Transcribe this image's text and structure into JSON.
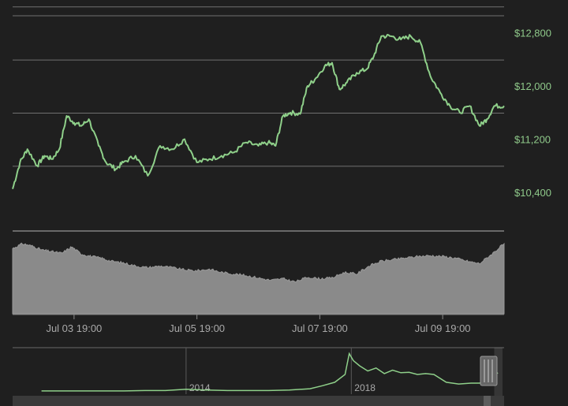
{
  "chart_data": [
    {
      "type": "line",
      "title": "",
      "xlabel": "",
      "ylabel": "",
      "ylim": [
        10150,
        13200
      ],
      "y_ticks": [
        {
          "value": 12800,
          "label": "$12,800"
        },
        {
          "value": 12000,
          "label": "$12,000"
        },
        {
          "value": 11200,
          "label": "$11,200"
        },
        {
          "value": 10400,
          "label": "$10,400"
        }
      ],
      "series": [
        {
          "color": "#8fd08a",
          "x": [
            0,
            0.3,
            0.6,
            1.0,
            1.3,
            1.6,
            1.9,
            2.2,
            2.5,
            2.8,
            3.1,
            3.5,
            3.8,
            4.2,
            4.5,
            5.0,
            5.5,
            6.0,
            6.5,
            7.0,
            7.5,
            8.0,
            8.5,
            9.0,
            9.5,
            10.0,
            10.4,
            10.7,
            11.0,
            11.3,
            11.7,
            12.0,
            12.3,
            12.7,
            13.0,
            13.3,
            13.6,
            14.0,
            14.4,
            14.7,
            15.0,
            15.4,
            15.8,
            16.2,
            16.6,
            17.0,
            17.4,
            17.8,
            18.2,
            18.6,
            19.0,
            19.3,
            19.6,
            20.0
          ],
          "y": [
            10450,
            10850,
            11050,
            10800,
            10950,
            10900,
            11050,
            11550,
            11450,
            11400,
            11500,
            11100,
            10850,
            10750,
            10850,
            10950,
            10650,
            11100,
            11050,
            11200,
            10850,
            10900,
            10950,
            11000,
            11150,
            11100,
            11150,
            11100,
            11550,
            11600,
            11580,
            12000,
            12100,
            12300,
            12350,
            11950,
            12050,
            12200,
            12250,
            12450,
            12750,
            12750,
            12700,
            12750,
            12650,
            12150,
            11900,
            11700,
            11600,
            11700,
            11400,
            11500,
            11700,
            11700
          ]
        }
      ],
      "x_ticks": [
        {
          "value": 2.5,
          "label": "Jul 03 19:00"
        },
        {
          "value": 7.5,
          "label": "Jul 05 19:00"
        },
        {
          "value": 12.5,
          "label": "Jul 07 19:00"
        },
        {
          "value": 17.5,
          "label": "Jul 09 19:00"
        }
      ]
    },
    {
      "type": "area",
      "title": "",
      "xlabel": "",
      "ylabel": "",
      "ylim": [
        0,
        100
      ],
      "series": [
        {
          "color": "#8a8a8a",
          "x": [
            0,
            0.4,
            0.8,
            1.2,
            1.6,
            2.0,
            2.4,
            2.8,
            3.2,
            3.6,
            4.0,
            4.5,
            5.0,
            5.5,
            6.0,
            6.5,
            7.0,
            7.5,
            8.0,
            8.5,
            9.0,
            9.5,
            10.0,
            10.5,
            11.0,
            11.5,
            12.0,
            12.5,
            13.0,
            13.5,
            14.0,
            14.5,
            15.0,
            15.5,
            16.0,
            16.5,
            17.0,
            17.5,
            18.0,
            18.5,
            19.0,
            19.5,
            20.0
          ],
          "y": [
            82,
            88,
            85,
            80,
            78,
            76,
            84,
            75,
            72,
            70,
            66,
            64,
            60,
            58,
            60,
            58,
            55,
            54,
            56,
            52,
            50,
            48,
            45,
            42,
            44,
            40,
            46,
            44,
            45,
            52,
            50,
            60,
            66,
            68,
            70,
            72,
            73,
            72,
            70,
            66,
            63,
            75,
            88
          ]
        }
      ]
    },
    {
      "type": "line",
      "title": "",
      "xlabel": "",
      "ylabel": "",
      "ylim": [
        0,
        100
      ],
      "series": [
        {
          "color": "#8fd08a",
          "x": [
            2010.5,
            2011.5,
            2012.5,
            2013.0,
            2013.5,
            2014.0,
            2014.5,
            2015.0,
            2015.5,
            2016.0,
            2016.5,
            2017.0,
            2017.3,
            2017.6,
            2017.85,
            2017.95,
            2018.05,
            2018.2,
            2018.4,
            2018.6,
            2018.8,
            2019.0,
            2019.2,
            2019.4,
            2019.6,
            2019.8,
            2020.0,
            2020.3,
            2020.6,
            2020.9,
            2021.1,
            2021.3,
            2021.55
          ],
          "y": [
            2,
            2,
            2,
            3,
            3,
            6,
            4,
            3,
            3,
            3,
            4,
            7,
            14,
            22,
            40,
            88,
            72,
            60,
            48,
            55,
            42,
            50,
            44,
            45,
            40,
            42,
            40,
            22,
            18,
            20,
            20,
            23,
            44
          ]
        }
      ],
      "x_ticks": [
        {
          "value": 2014,
          "label": "2014"
        },
        {
          "value": 2018,
          "label": "2018"
        }
      ],
      "selected_range": [
        2021.5,
        2021.7
      ]
    }
  ]
}
